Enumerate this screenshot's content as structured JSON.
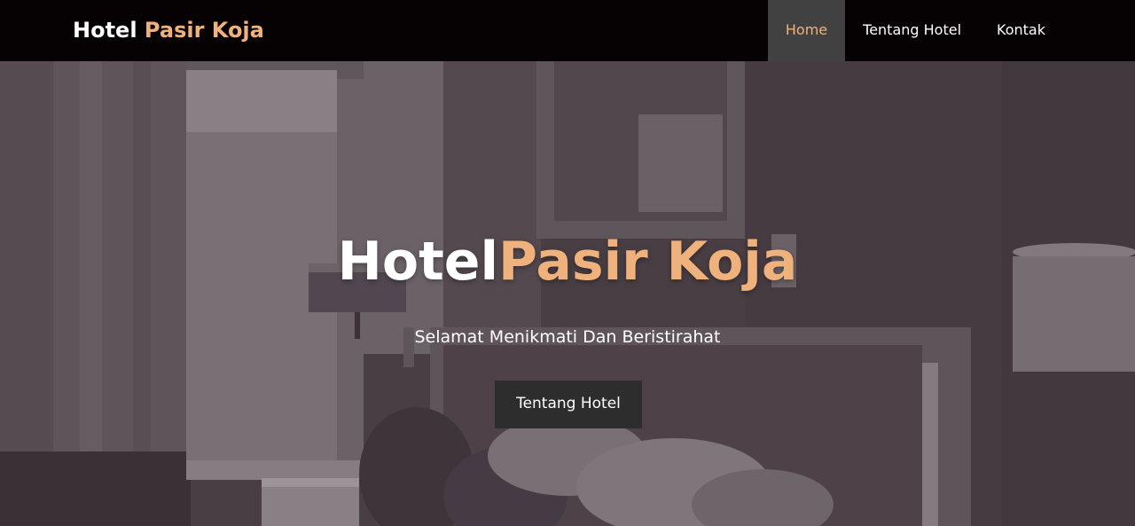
{
  "brand": {
    "word1": "Hotel",
    "word2": "Pasir Koja"
  },
  "nav": {
    "items": [
      {
        "label": "Home",
        "active": true
      },
      {
        "label": "Tentang Hotel",
        "active": false
      },
      {
        "label": "Kontak",
        "active": false
      }
    ]
  },
  "hero": {
    "title_part1": "Hotel",
    "title_part2": "Pasir Koja",
    "subtitle": "Selamat Menikmati Dan Beristirahat",
    "button_label": "Tentang Hotel",
    "background_image": "hotel-room-photo"
  },
  "colors": {
    "accent": "#f0b27c",
    "navbar_bg": "#060102",
    "active_nav_bg": "#414141",
    "button_bg": "#2d2d2d"
  }
}
